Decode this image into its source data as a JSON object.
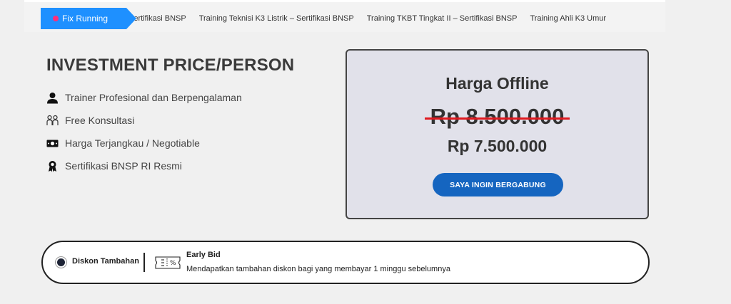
{
  "ticker": {
    "badge": "Fix Running",
    "items": [
      "Sertifikasi BNSP",
      "Training Teknisi K3 Listrik – Sertifikasi BNSP",
      "Training TKBT Tingkat II – Sertifikasi BNSP",
      "Training Ahli K3 Umur"
    ]
  },
  "investment": {
    "title": "INVESTMENT PRICE/PERSON",
    "features": [
      {
        "icon": "user-icon",
        "label": "Trainer Profesional dan Berpengalaman"
      },
      {
        "icon": "consultation-icon",
        "label": "Free Konsultasi"
      },
      {
        "icon": "money-icon",
        "label": "Harga Terjangkau / Negotiable"
      },
      {
        "icon": "certificate-icon",
        "label": "Sertifikasi BNSP RI Resmi"
      }
    ]
  },
  "pricing": {
    "title": "Harga Offline",
    "old_price": "Rp 8.500.000",
    "new_price": "Rp 7.500.000",
    "button": "SAYA INGIN BERGABUNG"
  },
  "discount": {
    "label": "Diskon Tambahan",
    "title": "Early Bid",
    "description": "Mendapatkan tambahan diskon bagi yang membayar 1 minggu sebelumnya"
  },
  "colors": {
    "accent": "#1565c0",
    "ticker_badge": "#1e90ff",
    "strike": "#e0191f",
    "card_bg": "#e1e1ea"
  }
}
